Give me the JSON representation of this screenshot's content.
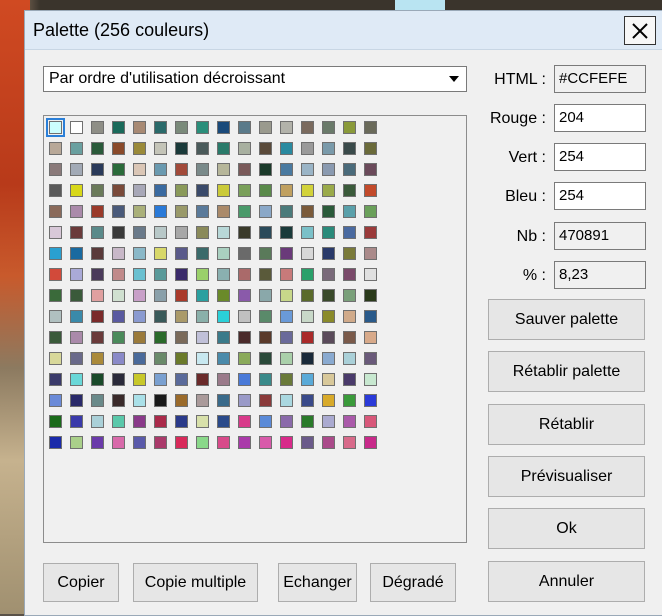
{
  "window": {
    "title": "Palette (256 couleurs)"
  },
  "sort": {
    "selected": "Par ordre d'utilisation décroissant"
  },
  "fields": {
    "html": {
      "label": "HTML :",
      "value": "#CCFEFE"
    },
    "rouge": {
      "label": "Rouge :",
      "value": "204"
    },
    "vert": {
      "label": "Vert :",
      "value": "254"
    },
    "bleu": {
      "label": "Bleu :",
      "value": "254"
    },
    "nb": {
      "label": "Nb :",
      "value": "470891"
    },
    "pct": {
      "label": "% :",
      "value": "8,23"
    }
  },
  "buttons": {
    "save": "Sauver palette",
    "restore_palette": "Rétablir palette",
    "restore": "Rétablir",
    "preview": "Prévisualiser",
    "ok": "Ok",
    "cancel": "Annuler",
    "copy": "Copier",
    "copy_multi": "Copie multiple",
    "swap": "Echanger",
    "gradient": "Dégradé"
  },
  "palette": {
    "colors": [
      "#ccfefe",
      "#ffffff",
      "#8e8e86",
      "#1a6a5a",
      "#a88a74",
      "#2a6a6a",
      "#7a8a7a",
      "#2a8e7a",
      "#1a4a7a",
      "#5a7a8a",
      "#9a9a8e",
      "#b2b2aa",
      "#7a6a5e",
      "#6a7a6a",
      "#8a9a3a",
      "#6a6a5a",
      "#b8a898",
      "#6aa0a0",
      "#2a5a3a",
      "#8a4a2a",
      "#9a8a3a",
      "#c4c4b8",
      "#1a3a3a",
      "#4a5a5a",
      "#2a7a6a",
      "#a8b0a0",
      "#5a4a3a",
      "#2a8aa0",
      "#9a9a9a",
      "#7a9aaa",
      "#3a4a4a",
      "#6a6a3a",
      "#8a7a7a",
      "#a2aab6",
      "#2a3a5a",
      "#2a6a3a",
      "#dac6b6",
      "#6a9ab0",
      "#a24a3a",
      "#7a8a8a",
      "#b6b69a",
      "#7a5a5a",
      "#1a3a2a",
      "#4a7aa0",
      "#9ab4c6",
      "#8a9ab0",
      "#4a6a7a",
      "#6a4a5a",
      "#5a5a5a",
      "#d8d81a",
      "#6a7a5a",
      "#7a4a3a",
      "#a8a8b8",
      "#3a6aa0",
      "#8a9a5a",
      "#3a4a6a",
      "#caca3a",
      "#7aa05a",
      "#5a8a4a",
      "#c0a060",
      "#d2d23a",
      "#9aaa4a",
      "#3a5a3a",
      "#c24a2a",
      "#8a6a5a",
      "#aa8aaa",
      "#9a3a2a",
      "#4a5a7a",
      "#aab07a",
      "#2a7ad8",
      "#9a9a6a",
      "#5a7a9a",
      "#aa8a6a",
      "#4a9a6a",
      "#8aa8c8",
      "#4a7a7a",
      "#7a5a3a",
      "#2a5a3a",
      "#5aa0aa",
      "#6aa05a",
      "#d8c8d8",
      "#6a3a3a",
      "#5a8a8a",
      "#3a3a3a",
      "#6a7a8a",
      "#b8c8c8",
      "#a8a8a8",
      "#8a8a5a",
      "#b8d8d8",
      "#3a3a2a",
      "#2a4a5a",
      "#1a3a3a",
      "#7ac0c8",
      "#2a8a7a",
      "#4a6aa0",
      "#9a3a3a",
      "#2aa0d0",
      "#1a6aa0",
      "#5a3a3a",
      "#c8b8c8",
      "#8ab8c8",
      "#d8d86a",
      "#5a5a8a",
      "#3a6a6a",
      "#aad0c0",
      "#6a6a6a",
      "#5a7a5a",
      "#6a3a7a",
      "#d8d8d8",
      "#2a3a6a",
      "#7a7a3a",
      "#aa8a8a",
      "#d24a3a",
      "#aaaad8",
      "#4a3a5a",
      "#c08a8a",
      "#6ac0d0",
      "#5a9a9a",
      "#3a2a6a",
      "#9ad06a",
      "#8ab0b0",
      "#aa6a6a",
      "#5a5a3a",
      "#c87a7a",
      "#2aa06a",
      "#7a6a7a",
      "#7a4a6a",
      "#e0e0e0",
      "#3a6a3a",
      "#3a5a3a",
      "#e0a0a0",
      "#d0e0d0",
      "#c8a0c8",
      "#8aa0aa",
      "#aa3a2a",
      "#2aa0a0",
      "#6a8a2a",
      "#8a5aaa",
      "#8aa8aa",
      "#c8d88a",
      "#5a6a2a",
      "#3a4a2a",
      "#7aa07a",
      "#2a3a1a",
      "#b0c0c0",
      "#3a8aaa",
      "#7a2a2a",
      "#5a5aa0",
      "#8a9ad0",
      "#3a5a5a",
      "#aa9a6a",
      "#8ab0aa",
      "#2ad0d8",
      "#c0c0c0",
      "#5a8a6a",
      "#6a9ad8",
      "#c8d8c8",
      "#8a8a2a",
      "#d0aa8a",
      "#2a5a8a",
      "#3a5a3a",
      "#aa8aaa",
      "#6a3a3a",
      "#4a8a5a",
      "#9a7a3a",
      "#2a6a2a",
      "#7a6a5a",
      "#c0c0d8",
      "#3a7a8a",
      "#4a2a2a",
      "#5a3a2a",
      "#6a6a9a",
      "#aa2a2a",
      "#5a4a5a",
      "#7a5a4a",
      "#d8aa8a",
      "#d8d89a",
      "#6a6a8a",
      "#aa8a3a",
      "#8a8ac8",
      "#4a6a9a",
      "#6a8a6a",
      "#6a7a2a",
      "#c8e8f0",
      "#4a8aaa",
      "#8aaa5a",
      "#2a4a3a",
      "#aad0aa",
      "#1a2a3a",
      "#8aaad0",
      "#aad0d8",
      "#6a5a7a",
      "#3a3a6a",
      "#6ad8d8",
      "#1a4a2a",
      "#2a2a3a",
      "#c8c82a",
      "#7aa0d0",
      "#5a6a9a",
      "#6a2a2a",
      "#9a7a8a",
      "#4a7ad8",
      "#3a8a8a",
      "#6a7a3a",
      "#5aaad8",
      "#d8c89a",
      "#4a3a6a",
      "#c8e8d0",
      "#6a8ad8",
      "#2a2a6a",
      "#6a8a8a",
      "#3a2a2a",
      "#aae0e8",
      "#1a1a1a",
      "#9a6a2a",
      "#aa9a9a",
      "#3a6a8a",
      "#9a9ac8",
      "#8a3a3a",
      "#aad8e0",
      "#3a4a8a",
      "#d8aa2a",
      "#3a9a3a",
      "#2a3ad8",
      "#1a6a1a",
      "#3a3aaa",
      "#aad0d8",
      "#5ac8aa",
      "#8a3a8a",
      "#aa2a4a",
      "#2a3a8a",
      "#d8e0aa",
      "#2a4a8a",
      "#d83a8a",
      "#5a8ad8",
      "#8a6aaa",
      "#2a7a2a",
      "#aaaad0",
      "#aa5aaa",
      "#d8587a",
      "#1a2aaa",
      "#aad08a",
      "#6a3aaa",
      "#d86aaa",
      "#5a5aaa",
      "#aa3a6a",
      "#d82a5a",
      "#8ad88a",
      "#d84a8a",
      "#aa3aaa",
      "#d85aaa",
      "#d82a8a",
      "#6a5a8a",
      "#aa4a8a",
      "#d86a8a",
      "#c82a8a"
    ]
  }
}
